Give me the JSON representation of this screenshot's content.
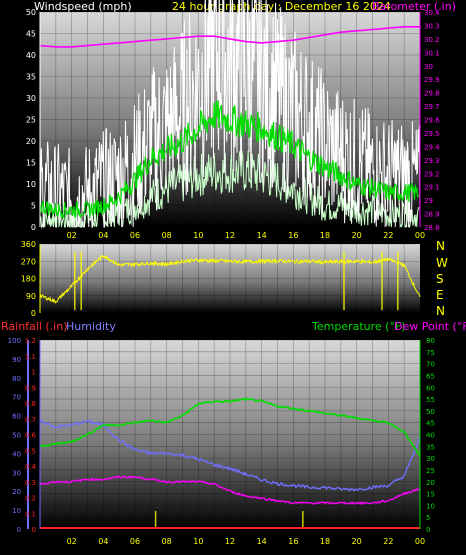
{
  "header": {
    "wind_label": "Windspeed (mph)",
    "title": "24 hour graph day : December 16 2024",
    "baro_label": "Barometer (.in)"
  },
  "panel3": {
    "rain_label": "Rainfall (.in)",
    "humidity_label": "Humidity",
    "temp_label": "Temperature (°F)",
    "dew_label": "Dew Point (°F)"
  },
  "compass": [
    "N",
    "W",
    "S",
    "E",
    "N"
  ],
  "colors": {
    "wind": "#ffffff",
    "wind_avg": "#00dd00",
    "wind_low": "#c8ffc8",
    "barometer": "#ff00ff",
    "direction": "#ffff00",
    "rain": "#ff2020",
    "humidity": "#7070ff",
    "temperature": "#00dd00",
    "dewpoint": "#ff00ff",
    "rain_rate": "#cccc00",
    "axis": "#ffff00"
  },
  "chart_data": [
    {
      "type": "line",
      "title": "24 hour graph day : December 16 2024",
      "x_ticks": [
        "02",
        "04",
        "06",
        "08",
        "10",
        "12",
        "14",
        "16",
        "18",
        "20",
        "22",
        "00"
      ],
      "x_range_hours": [
        0,
        24
      ],
      "y_left": {
        "label": "Windspeed (mph)",
        "range": [
          0,
          50
        ],
        "ticks": [
          0,
          5,
          10,
          15,
          20,
          25,
          30,
          35,
          40,
          45,
          50
        ]
      },
      "y_right": {
        "label": "Barometer (.in)",
        "range": [
          28.8,
          30.4
        ],
        "ticks": [
          "28.8",
          "28.9",
          "29",
          "29.1",
          "29.2",
          "29.3",
          "29.4",
          "29.5",
          "29.6",
          "29.7",
          "29.8",
          "29.9",
          "30",
          "30.1",
          "30.2",
          "30.3",
          "30.4"
        ]
      },
      "hours": [
        0,
        1,
        2,
        3,
        4,
        5,
        6,
        7,
        8,
        9,
        10,
        11,
        12,
        13,
        14,
        15,
        16,
        17,
        18,
        19,
        20,
        21,
        22,
        23,
        24
      ],
      "series": [
        {
          "name": "Windspeed (mph)",
          "axis": "left",
          "values": [
            9,
            8,
            7,
            8,
            10,
            12,
            15,
            20,
            23,
            27,
            33,
            40,
            38,
            36,
            34,
            30,
            27,
            23,
            19,
            17,
            15,
            13,
            12,
            12,
            11
          ]
        },
        {
          "name": "avg",
          "axis": "left",
          "values": [
            5,
            4,
            4,
            4,
            5,
            7,
            11,
            16,
            18,
            20,
            23,
            26,
            25,
            24,
            23,
            21,
            19,
            16,
            14,
            12,
            10,
            9,
            8,
            8,
            8
          ]
        },
        {
          "name": "low",
          "axis": "left",
          "values": [
            2,
            2,
            1,
            2,
            2,
            3,
            5,
            7,
            9,
            10,
            12,
            13,
            13,
            13,
            12,
            11,
            9,
            7,
            5,
            5,
            4,
            4,
            3,
            3,
            3
          ]
        },
        {
          "name": "Barometer (.in)",
          "axis": "right",
          "values": [
            30.15,
            30.14,
            30.14,
            30.15,
            30.16,
            30.17,
            30.18,
            30.19,
            30.2,
            30.21,
            30.22,
            30.22,
            30.2,
            30.18,
            30.17,
            30.18,
            30.19,
            30.21,
            30.23,
            30.25,
            30.26,
            30.27,
            30.28,
            30.29,
            30.29
          ]
        }
      ]
    },
    {
      "type": "line",
      "title": "",
      "x_range_hours": [
        0,
        24
      ],
      "y_left": {
        "range": [
          0,
          360
        ],
        "ticks": [
          0,
          90,
          180,
          270,
          360
        ]
      },
      "hours": [
        0,
        1,
        2,
        3,
        4,
        5,
        6,
        7,
        8,
        9,
        10,
        11,
        12,
        13,
        14,
        15,
        16,
        17,
        18,
        19,
        20,
        21,
        22,
        23,
        24
      ],
      "series": [
        {
          "name": "direction",
          "axis": "left",
          "values": [
            90,
            60,
            140,
            230,
            300,
            250,
            255,
            260,
            255,
            270,
            275,
            272,
            270,
            268,
            270,
            272,
            268,
            270,
            265,
            268,
            270,
            265,
            280,
            250,
            80
          ]
        }
      ]
    },
    {
      "type": "line",
      "title": "",
      "x_ticks": [
        "02",
        "04",
        "06",
        "08",
        "10",
        "12",
        "14",
        "16",
        "18",
        "20",
        "22",
        "00"
      ],
      "x_range_hours": [
        0,
        24
      ],
      "y_rain": {
        "label": "Rainfall (.in)",
        "range": [
          0,
          1.2
        ],
        "ticks": [
          "0",
          "0.1",
          "0.2",
          "0.3",
          "0.4",
          "0.5",
          "0.6",
          "0.7",
          "0.8",
          "0.9",
          "1",
          "1.1",
          "1.2"
        ]
      },
      "y_humidity": {
        "label": "Humidity",
        "range": [
          0,
          100
        ],
        "ticks": [
          0,
          10,
          20,
          30,
          40,
          50,
          60,
          70,
          80,
          90,
          100
        ]
      },
      "y_temp": {
        "label": "Temperature (°F)",
        "range": [
          0,
          80
        ],
        "ticks": [
          0,
          5,
          10,
          15,
          20,
          25,
          30,
          35,
          40,
          45,
          50,
          55,
          60,
          65,
          70,
          75,
          80
        ]
      },
      "hours": [
        0,
        1,
        2,
        3,
        4,
        5,
        6,
        7,
        8,
        9,
        10,
        11,
        12,
        13,
        14,
        15,
        16,
        17,
        18,
        19,
        20,
        21,
        22,
        23,
        24
      ],
      "series": [
        {
          "name": "Humidity",
          "axis": "humidity",
          "values": [
            57,
            54,
            55,
            57,
            55,
            47,
            42,
            40,
            40,
            39,
            37,
            34,
            32,
            29,
            26,
            24,
            23,
            22,
            22,
            21,
            21,
            22,
            23,
            28,
            48
          ]
        },
        {
          "name": "Temperature (°F)",
          "axis": "temp",
          "values": [
            35,
            36,
            37,
            40,
            44,
            44,
            45,
            46,
            45,
            48,
            53,
            54,
            54,
            55,
            54,
            52,
            51,
            50,
            49,
            48,
            47,
            46,
            45,
            41,
            31
          ]
        },
        {
          "name": "Dew Point (°F)",
          "axis": "temp",
          "values": [
            19,
            20,
            20,
            21,
            21,
            22,
            22,
            21,
            20,
            20,
            20,
            19,
            16,
            14,
            13,
            12,
            11,
            11,
            11,
            11,
            11,
            11,
            12,
            15,
            17
          ]
        },
        {
          "name": "Rainfall (.in)",
          "axis": "rain",
          "values": [
            0,
            0,
            0,
            0,
            0,
            0,
            0,
            0,
            0,
            0,
            0,
            0,
            0,
            0,
            0,
            0,
            0,
            0,
            0,
            0,
            0,
            0,
            0,
            0,
            0
          ]
        }
      ]
    }
  ]
}
